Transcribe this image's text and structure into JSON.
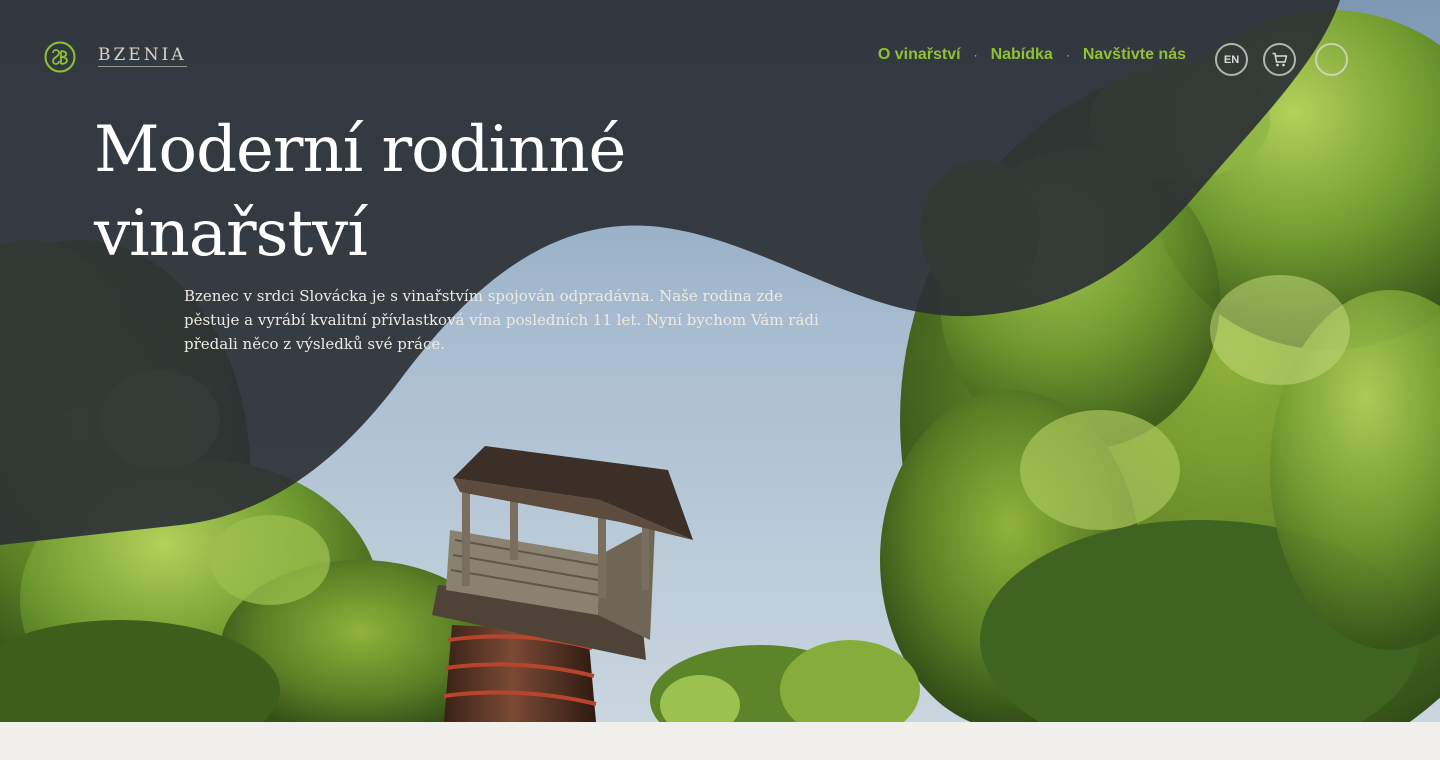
{
  "brand": {
    "name": "BZENIA",
    "logo_icon": "bzenia-monogram-icon"
  },
  "nav": {
    "items": [
      {
        "label": "O vinařství"
      },
      {
        "label": "Nabídka"
      },
      {
        "label": "Navštivte nás"
      }
    ],
    "separator": "·"
  },
  "header_actions": {
    "language_label": "EN",
    "cart_icon": "cart-icon",
    "account_icon": "account-circle-icon"
  },
  "hero": {
    "title": "Moderní rodinné vinařství",
    "text": "Bzenec v srdci Slovácka je s vinařstvím spojován odpradávna. Naše rodina zde pěstuje a vyrábí kvalitní přívlastková vína posledních 11 let. Nyní bychom Vám rádi předali něco z výsledků své práce."
  },
  "colors": {
    "accent_green": "#8fc231",
    "overlay_dark": "#2f3338",
    "page_background": "#f1f0ec"
  }
}
